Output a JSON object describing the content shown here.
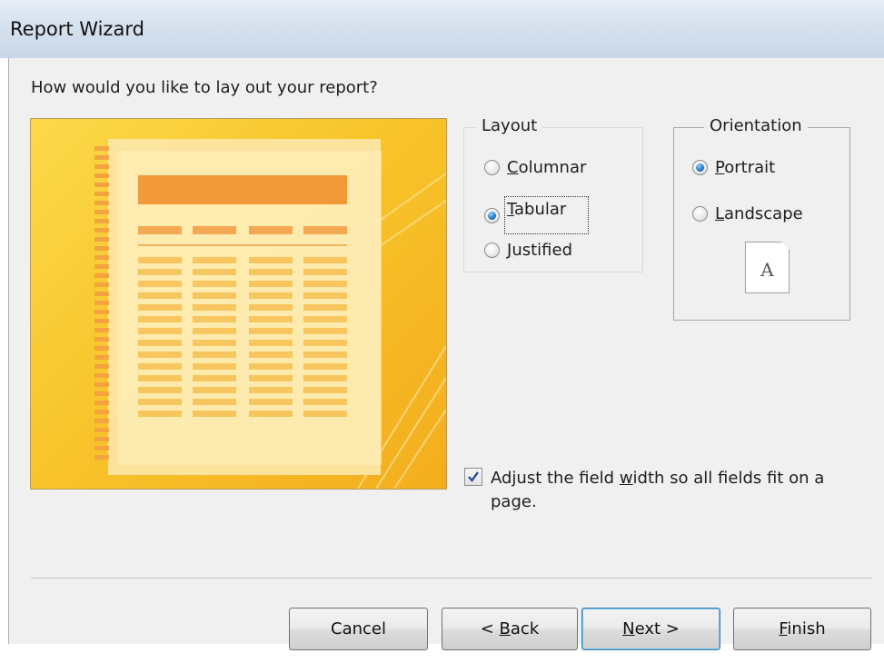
{
  "window": {
    "title": "Report Wizard"
  },
  "prompt": "How would you like to lay out your report?",
  "layout_group": {
    "title": "Layout",
    "options": [
      {
        "label": "Columnar",
        "mnemonic": "C",
        "rest": "olumnar",
        "selected": false
      },
      {
        "label": "Tabular",
        "mnemonic": "T",
        "rest": "abular",
        "selected": true
      },
      {
        "label": "Justified",
        "mnemonic": "J",
        "rest": "ustified",
        "selected": false
      }
    ]
  },
  "orientation_group": {
    "title": "Orientation",
    "options": [
      {
        "label": "Portrait",
        "mnemonic": "P",
        "rest": "ortrait",
        "selected": true
      },
      {
        "label": "Landscape",
        "mnemonic": "L",
        "rest": "andscape",
        "selected": false
      }
    ],
    "page_icon_letter": "A"
  },
  "adjust_checkbox": {
    "checked": true,
    "label_part1": "Adjust the field ",
    "label_mnemonic": "w",
    "label_part2": "idth so all fields fit on a page."
  },
  "buttons": {
    "cancel": "Cancel",
    "back_prefix": "< ",
    "back_mnemonic": "B",
    "back_rest": "ack",
    "next_mnemonic": "N",
    "next_rest": "ext >",
    "finish_mnemonic": "F",
    "finish_rest": "inish"
  },
  "colors": {
    "preview_bg": "#f8c52b",
    "preview_page": "#fce6a6",
    "header_bar": "#f29a3a",
    "radio_selected": "#2a7fc8"
  }
}
